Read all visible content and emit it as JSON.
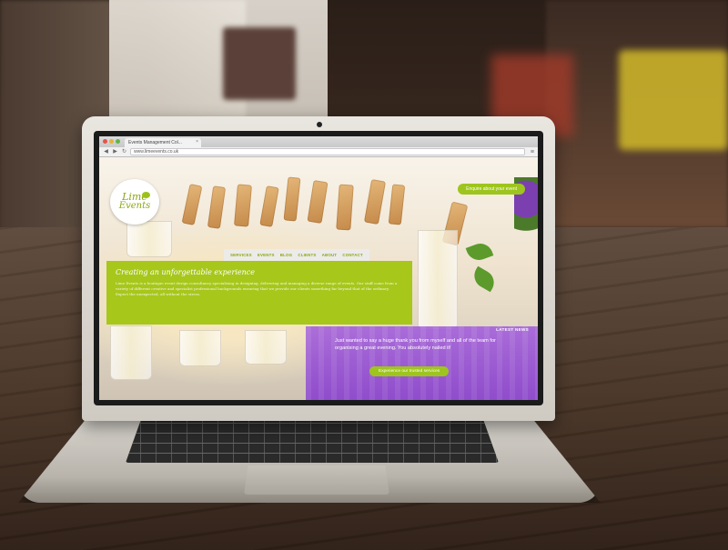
{
  "browser": {
    "tab_title": "Events Management Col...",
    "url": "www.limeevents.co.uk"
  },
  "site": {
    "logo_line1": "Lime",
    "logo_line2": "Events",
    "cta_top": "Enquire about your event",
    "nav": [
      "SERVICES",
      "EVENTS",
      "BLOG",
      "CLIENTS",
      "ABOUT",
      "CONTACT"
    ],
    "intro_title": "Creating an unforgettable experience",
    "intro_body": "Lime Events is a boutique event design consultancy specialising in designing, delivering and managing a diverse range of events. Our staff come from a variety of different creative and specialist professional backgrounds ensuring that we provide our clients something far beyond that of the ordinary. Expect the unexpected, all without the stress.",
    "news_label": "LATEST NEWS",
    "news_quote": "Just wanted to say a huge thank you from myself and all of the team for organising a great evening. You absolutely nailed it!",
    "news_button": "Experience our trusted services"
  },
  "colors": {
    "brand_lime": "#a7c71b",
    "news_purple": "#8c46cd"
  }
}
